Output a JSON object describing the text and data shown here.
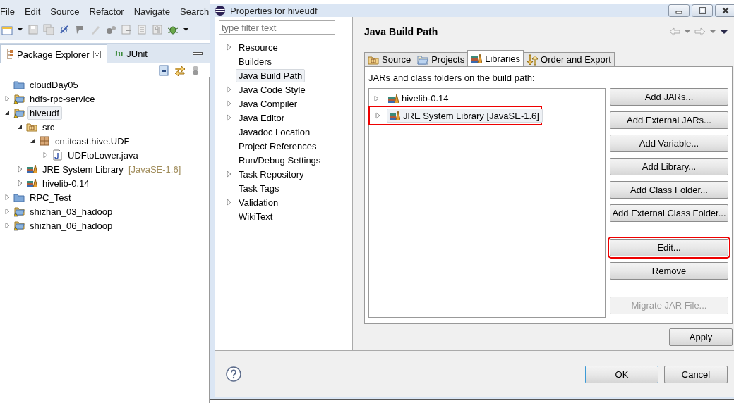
{
  "workbench": {
    "menu": [
      "File",
      "Edit",
      "Source",
      "Refactor",
      "Navigate",
      "Search"
    ],
    "views": [
      {
        "label": "Package Explorer",
        "kind": "explorer",
        "selected": true
      },
      {
        "label": "JUnit",
        "kind": "junit",
        "badge": "Ju",
        "selected": false
      }
    ],
    "tree": [
      {
        "label": "cloudDay05",
        "kind": "closed-project",
        "selected": false
      },
      {
        "label": "hdfs-rpc-service",
        "kind": "project",
        "selected": false,
        "expanded": false
      },
      {
        "label": "hiveudf",
        "kind": "project",
        "selected": true,
        "expanded": true,
        "children": [
          {
            "label": "src",
            "kind": "source-folder",
            "selected": false,
            "expanded": true,
            "children": [
              {
                "label": "cn.itcast.hive.UDF",
                "kind": "package",
                "selected": false,
                "expanded": true,
                "children": [
                  {
                    "label": "UDFtoLower.java",
                    "kind": "java-file",
                    "selected": false,
                    "expanded": false
                  }
                ]
              }
            ]
          },
          {
            "label": "JRE System Library",
            "note": "[JavaSE-1.6]",
            "kind": "library",
            "selected": false,
            "expanded": false
          },
          {
            "label": "hivelib-0.14",
            "kind": "library",
            "selected": false,
            "expanded": false
          }
        ]
      },
      {
        "label": "RPC_Test",
        "kind": "closed-project",
        "selected": false,
        "expanded": false
      },
      {
        "label": "shizhan_03_hadoop",
        "kind": "project",
        "selected": false,
        "expanded": false
      },
      {
        "label": "shizhan_06_hadoop",
        "kind": "project",
        "selected": false,
        "expanded": false
      }
    ]
  },
  "dialog": {
    "title": "Properties for hiveudf",
    "filter": {
      "placeholder": "type filter text"
    },
    "nav": [
      {
        "label": "Resource",
        "expandable": true,
        "selected": false
      },
      {
        "label": "Builders",
        "expandable": false,
        "selected": false
      },
      {
        "label": "Java Build Path",
        "expandable": false,
        "selected": true
      },
      {
        "label": "Java Code Style",
        "expandable": true,
        "selected": false
      },
      {
        "label": "Java Compiler",
        "expandable": true,
        "selected": false
      },
      {
        "label": "Java Editor",
        "expandable": true,
        "selected": false
      },
      {
        "label": "Javadoc Location",
        "expandable": false,
        "selected": false
      },
      {
        "label": "Project References",
        "expandable": false,
        "selected": false
      },
      {
        "label": "Run/Debug Settings",
        "expandable": false,
        "selected": false
      },
      {
        "label": "Task Repository",
        "expandable": true,
        "selected": false
      },
      {
        "label": "Task Tags",
        "expandable": false,
        "selected": false
      },
      {
        "label": "Validation",
        "expandable": true,
        "selected": false
      },
      {
        "label": "WikiText",
        "expandable": false,
        "selected": false
      }
    ],
    "page_title": "Java Build Path",
    "tabs": [
      {
        "label": "Source",
        "kind": "source",
        "selected": false
      },
      {
        "label": "Projects",
        "kind": "projects",
        "selected": false
      },
      {
        "label": "Libraries",
        "kind": "libraries",
        "selected": true
      },
      {
        "label": "Order and Export",
        "kind": "order",
        "selected": false
      }
    ],
    "list_label": "JARs and class folders on the build path:",
    "entries": [
      {
        "label": "hivelib-0.14",
        "selected": false,
        "highlighted": false
      },
      {
        "label": "JRE System Library [JavaSE-1.6]",
        "selected": true,
        "highlighted": true
      }
    ],
    "button_groups": [
      [
        {
          "label": "Add JARs...",
          "disabled": false,
          "highlighted": false
        },
        {
          "label": "Add External JARs...",
          "disabled": false,
          "highlighted": false
        },
        {
          "label": "Add Variable...",
          "disabled": false,
          "highlighted": false
        },
        {
          "label": "Add Library...",
          "disabled": false,
          "highlighted": false
        },
        {
          "label": "Add Class Folder...",
          "disabled": false,
          "highlighted": false
        },
        {
          "label": "Add External Class Folder...",
          "disabled": false,
          "highlighted": false
        }
      ],
      [
        {
          "label": "Edit...",
          "disabled": false,
          "highlighted": true
        },
        {
          "label": "Remove",
          "disabled": false,
          "highlighted": false
        }
      ],
      [
        {
          "label": "Migrate JAR File...",
          "disabled": true,
          "highlighted": false
        }
      ]
    ],
    "apply": "Apply",
    "ok": "OK",
    "cancel": "Cancel"
  }
}
